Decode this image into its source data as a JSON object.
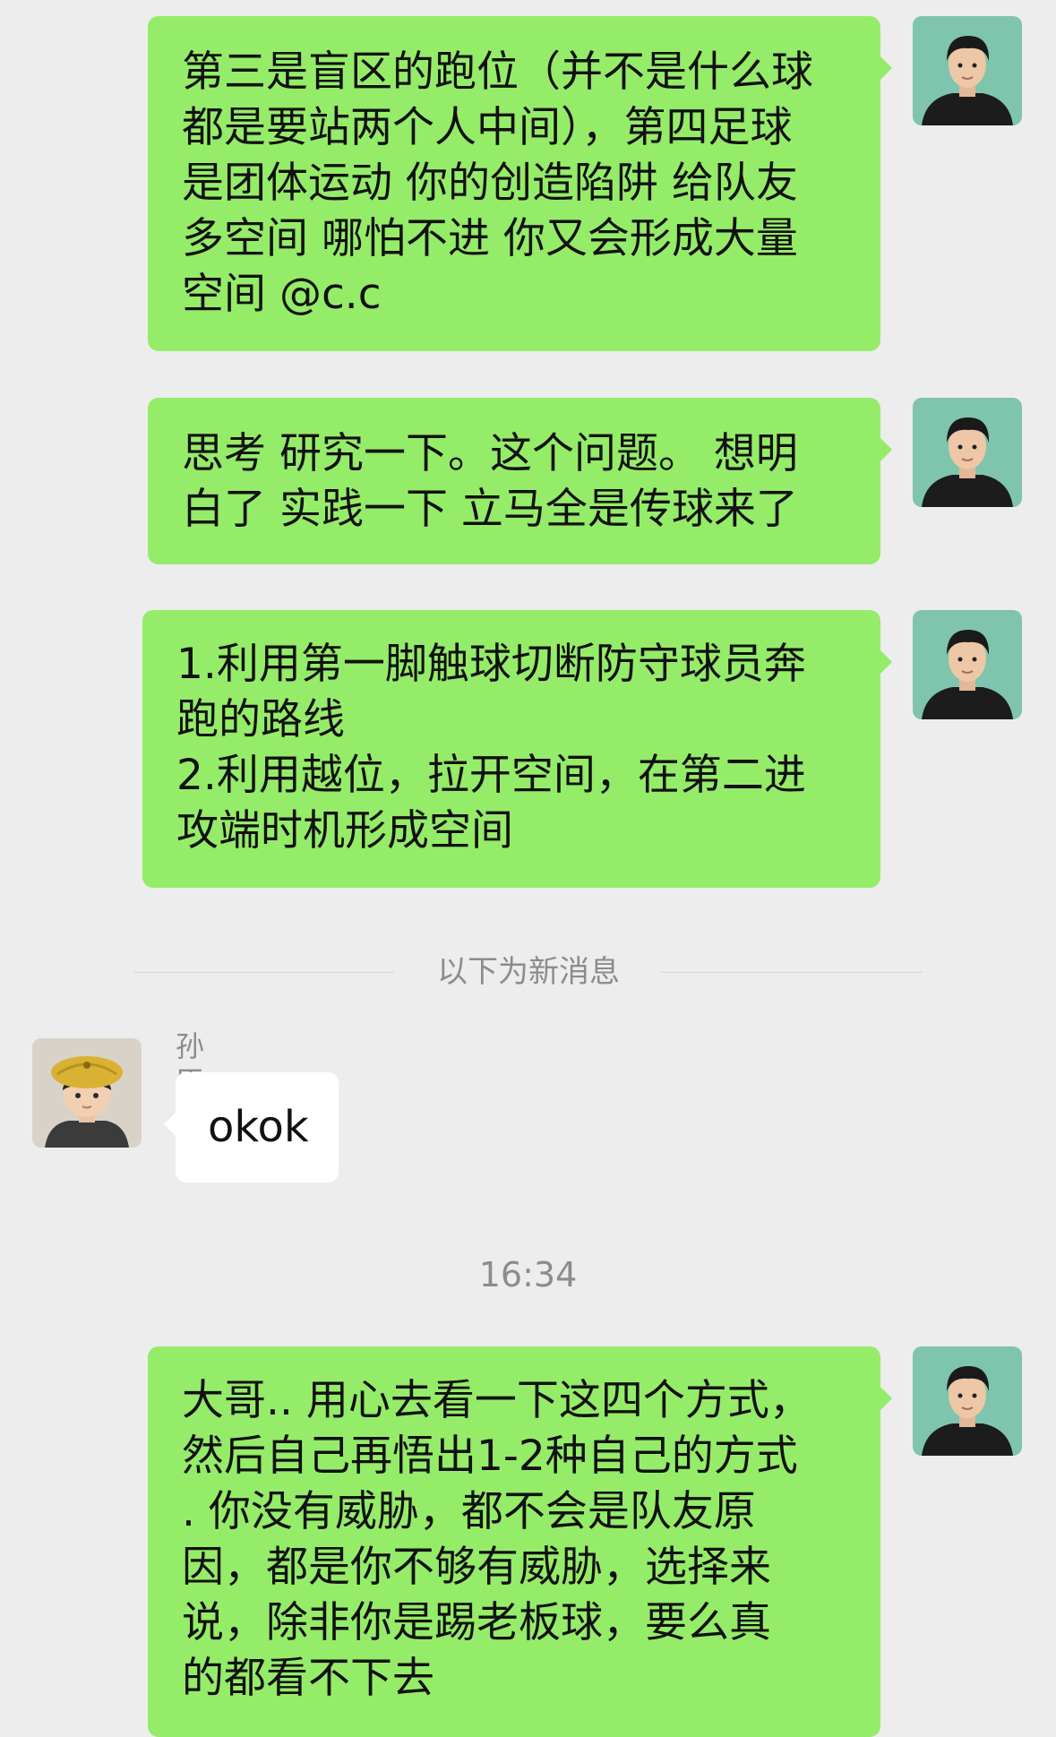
{
  "messages": [
    {
      "sender": "me",
      "lines": [
        "第三是盲区的跑位（并不是什么球",
        "都是要站两个人中间），第四足球",
        "是团体运动 你的创造陷阱 给队友",
        "多空间 哪怕不进 你又会形成大量",
        "空间 @c.c"
      ]
    },
    {
      "sender": "me",
      "lines": [
        "思考 研究一下。这个问题。 想明",
        "白了 实践一下 立马全是传球来了"
      ]
    },
    {
      "sender": "me",
      "lines": [
        "1.利用第一脚触球切断防守球员奔",
        "跑的路线",
        "2.利用越位，拉开空间，在第二进",
        "攻端时机形成空间"
      ]
    }
  ],
  "divider": {
    "label": "以下为新消息"
  },
  "incoming": {
    "sender_name": "孙臣曦",
    "text": "okok"
  },
  "timestamp": "16:34",
  "last_message": {
    "sender": "me",
    "lines": [
      "大哥.. 用心去看一下这四个方式，",
      "然后自己再悟出1-2种自己的方式",
      ". 你没有威胁，都不会是队友原",
      "因，都是你不够有威胁，选择来",
      "说，除非你是踢老板球，要么真",
      "的都看不下去"
    ]
  },
  "colors": {
    "background": "#ededed",
    "my_bubble": "#95ec69",
    "their_bubble": "#ffffff",
    "meta_text": "#8c8c8c"
  }
}
